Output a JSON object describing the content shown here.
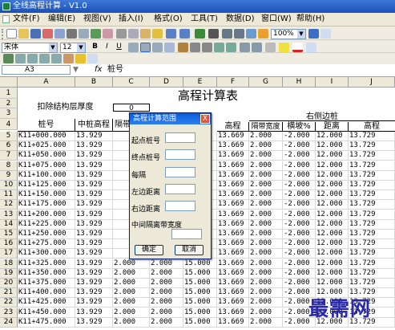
{
  "window": {
    "title": "全线高程计算 - V1.0"
  },
  "menu": [
    "文件(F)",
    "编辑(E)",
    "视图(V)",
    "插入(I)",
    "格式(O)",
    "工具(T)",
    "数据(D)",
    "窗口(W)",
    "帮助(H)"
  ],
  "toolbar": {
    "zoom": "100%"
  },
  "format_toolbar": {
    "font": "宋体",
    "size": "12"
  },
  "formula_bar": {
    "cell_ref": "A3",
    "fx": "fx",
    "content": "桩号"
  },
  "columns": [
    "A",
    "B",
    "C",
    "D",
    "E",
    "F",
    "G",
    "H",
    "I",
    "J"
  ],
  "sheet": {
    "title": "高程计算表",
    "deduct_label": "扣除结构层厚度",
    "deduct_value": "0",
    "right_edge": "右侧边桩",
    "headers": {
      "A": "桩号",
      "B": "中桩高程",
      "C": "隔带",
      "F": "高程",
      "G": "隔带宽度",
      "H": "横坡%",
      "I": "距离",
      "J": "高程"
    }
  },
  "rows": [
    [
      "K11+000.000",
      "13.929",
      "",
      "",
      "",
      "13.669",
      "2.000",
      "-2.000",
      "12.000",
      "13.729"
    ],
    [
      "K11+025.000",
      "13.929",
      "",
      "",
      "",
      "13.669",
      "2.000",
      "-2.000",
      "12.000",
      "13.729"
    ],
    [
      "K11+050.000",
      "13.929",
      "",
      "",
      "",
      "13.669",
      "2.000",
      "-2.000",
      "12.000",
      "13.729"
    ],
    [
      "K11+075.000",
      "13.929",
      "",
      "",
      "",
      "13.669",
      "2.000",
      "-2.000",
      "12.000",
      "13.729"
    ],
    [
      "K11+100.000",
      "13.929",
      "",
      "",
      "",
      "13.669",
      "2.000",
      "-2.000",
      "12.000",
      "13.729"
    ],
    [
      "K11+125.000",
      "13.929",
      "",
      "",
      "",
      "13.669",
      "2.000",
      "-2.000",
      "12.000",
      "13.729"
    ],
    [
      "K11+150.000",
      "13.929",
      "",
      "",
      "",
      "13.669",
      "2.000",
      "-2.000",
      "12.000",
      "13.729"
    ],
    [
      "K11+175.000",
      "13.929",
      "",
      "",
      "",
      "13.669",
      "2.000",
      "-2.000",
      "12.000",
      "13.729"
    ],
    [
      "K11+200.000",
      "13.929",
      "",
      "",
      "",
      "13.669",
      "2.000",
      "-2.000",
      "12.000",
      "13.729"
    ],
    [
      "K11+225.000",
      "13.929",
      "",
      "",
      "",
      "13.669",
      "2.000",
      "-2.000",
      "12.000",
      "13.729"
    ],
    [
      "K11+250.000",
      "13.929",
      "",
      "",
      "",
      "13.669",
      "2.000",
      "-2.000",
      "12.000",
      "13.729"
    ],
    [
      "K11+275.000",
      "13.929",
      "",
      "",
      "",
      "13.669",
      "2.000",
      "-2.000",
      "12.000",
      "13.729"
    ],
    [
      "K11+300.000",
      "13.929",
      "",
      "",
      "",
      "13.669",
      "2.000",
      "-2.000",
      "12.000",
      "13.729"
    ],
    [
      "K11+325.000",
      "13.929",
      "2.000",
      "2.000",
      "15.000",
      "13.669",
      "2.000",
      "-2.000",
      "12.000",
      "13.729"
    ],
    [
      "K11+350.000",
      "13.929",
      "2.000",
      "2.000",
      "15.000",
      "13.669",
      "2.000",
      "-2.000",
      "12.000",
      "13.729"
    ],
    [
      "K11+375.000",
      "13.929",
      "2.000",
      "2.000",
      "15.000",
      "13.669",
      "2.000",
      "-2.000",
      "12.000",
      "13.729"
    ],
    [
      "K11+400.000",
      "13.929",
      "2.000",
      "2.000",
      "15.000",
      "13.669",
      "2.000",
      "-2.000",
      "12.000",
      "13.729"
    ],
    [
      "K11+425.000",
      "13.929",
      "2.000",
      "2.000",
      "15.000",
      "13.669",
      "2.000",
      "-2.000",
      "12.000",
      "13.729"
    ],
    [
      "K11+450.000",
      "13.929",
      "2.000",
      "2.000",
      "15.000",
      "13.669",
      "2.000",
      "-2.000",
      "12.000",
      "13.729"
    ],
    [
      "K11+475.000",
      "13.929",
      "2.000",
      "2.000",
      "15.000",
      "13.669",
      "2.000",
      "-2.000",
      "12.000",
      "13.729"
    ]
  ],
  "dialog": {
    "title": "高程计算范围",
    "close": "X",
    "start_label": "起点桩号",
    "end_label": "终点桩号",
    "interval_label": "每隔",
    "left_label": "左边距离",
    "right_label": "右边距离",
    "median_label": "中间隔离带宽度",
    "ok_label": "确定",
    "cancel_label": "取消"
  },
  "watermark": "最需网",
  "colors": {
    "title_bar": "#1a4fb5",
    "dialog_title": "#0a5ad8",
    "watermark": "#2a2aa8"
  }
}
